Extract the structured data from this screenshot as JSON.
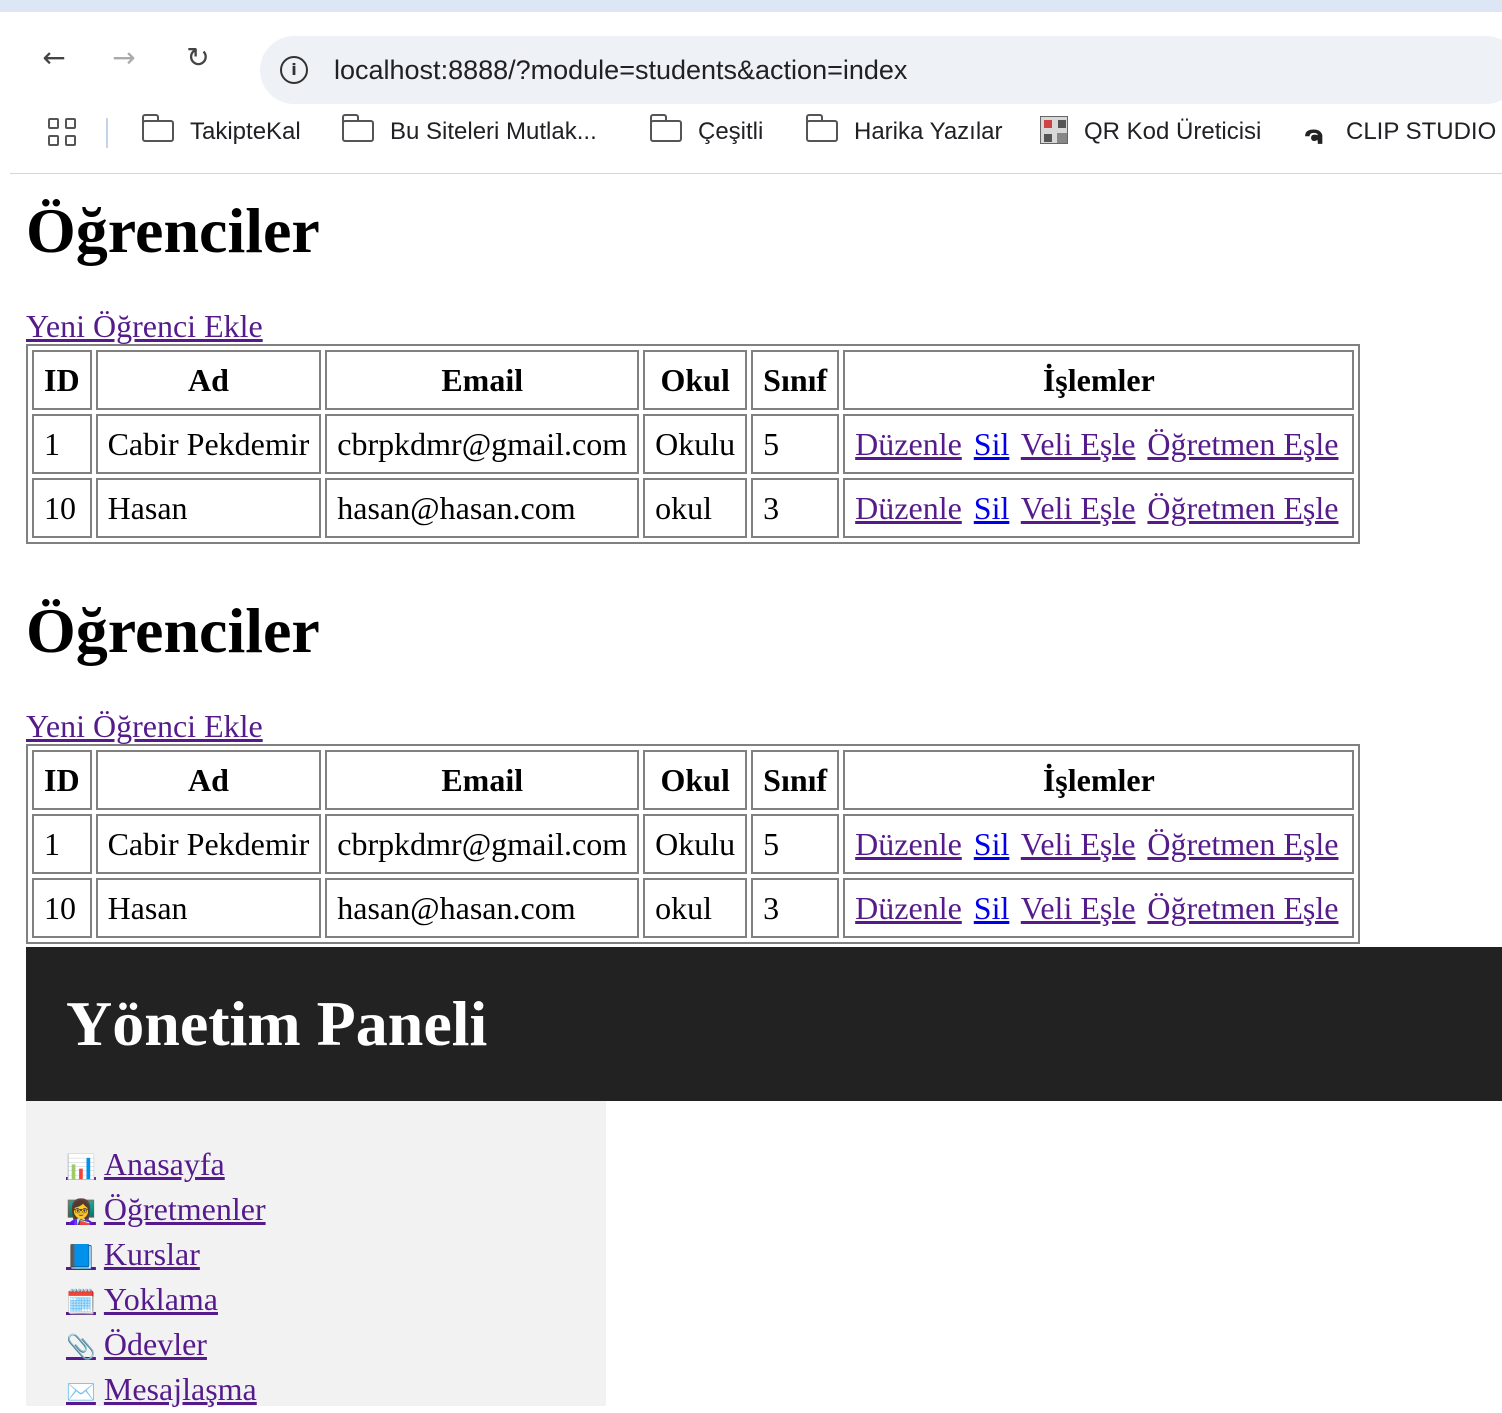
{
  "browser": {
    "url": "localhost:8888/?module=students&action=index",
    "bookmarks": [
      "TakipteKal",
      "Bu Siteleri Mutlak...",
      "Çeşitli",
      "Harika Yazılar",
      "QR Kod Üreticisi",
      "CLIP STUDIO"
    ]
  },
  "sections": [
    {
      "title": "Öğrenciler",
      "add_link": "Yeni Öğrenci Ekle",
      "headers": [
        "ID",
        "Ad",
        "Email",
        "Okul",
        "Sınıf",
        "İşlemler"
      ],
      "rows": [
        {
          "id": "1",
          "name": "Cabir Pekdemir",
          "email": "cbrpkdmr@gmail.com",
          "school": "Okulu",
          "grade": "5"
        },
        {
          "id": "10",
          "name": "Hasan",
          "email": "hasan@hasan.com",
          "school": "okul",
          "grade": "3"
        }
      ],
      "actions": [
        "Düzenle",
        "Sil",
        "Veli Eşle",
        "Öğretmen Eşle"
      ]
    },
    {
      "title": "Öğrenciler",
      "add_link": "Yeni Öğrenci Ekle",
      "headers": [
        "ID",
        "Ad",
        "Email",
        "Okul",
        "Sınıf",
        "İşlemler"
      ],
      "rows": [
        {
          "id": "1",
          "name": "Cabir Pekdemir",
          "email": "cbrpkdmr@gmail.com",
          "school": "Okulu",
          "grade": "5"
        },
        {
          "id": "10",
          "name": "Hasan",
          "email": "hasan@hasan.com",
          "school": "okul",
          "grade": "3"
        }
      ],
      "actions": [
        "Düzenle",
        "Sil",
        "Veli Eşle",
        "Öğretmen Eşle"
      ]
    }
  ],
  "admin": {
    "title": "Yönetim Paneli",
    "menu": [
      {
        "icon": "📊",
        "icon_name": "chart-icon",
        "label": "Anasayfa"
      },
      {
        "icon": "👩‍🏫",
        "icon_name": "teacher-icon",
        "label": "Öğretmenler"
      },
      {
        "icon": "📘",
        "icon_name": "book-icon",
        "label": "Kurslar"
      },
      {
        "icon": "🗓️",
        "icon_name": "calendar-icon",
        "label": "Yoklama"
      },
      {
        "icon": "📎",
        "icon_name": "paperclip-icon",
        "label": "Ödevler"
      },
      {
        "icon": "✉️",
        "icon_name": "envelope-icon",
        "label": "Mesajlaşma"
      }
    ]
  },
  "colors": {
    "visited_link": "#551a8b",
    "unvisited_link": "#0000ee",
    "admin_header_bg": "#222222",
    "sidebar_bg": "#f2f2f2"
  }
}
